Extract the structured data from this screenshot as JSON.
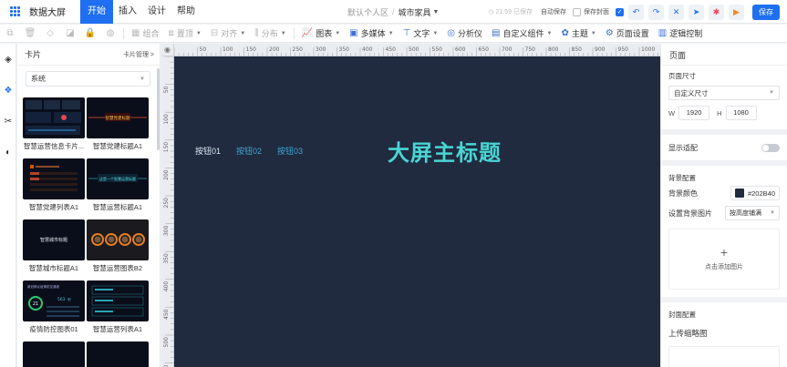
{
  "app": {
    "title": "数据大屏"
  },
  "menu": [
    {
      "label": "开始",
      "active": true
    },
    {
      "label": "插入",
      "active": false
    },
    {
      "label": "设计",
      "active": false
    },
    {
      "label": "帮助",
      "active": false
    }
  ],
  "breadcrumb": {
    "space": "默认个人区",
    "separator": "/",
    "current": "城市家具"
  },
  "header_tools": {
    "saved_time": "21:59 已保存",
    "auto_save_label": "自动保存",
    "save_cover_label": "保存封面",
    "save_button": "保存"
  },
  "toolbar": {
    "items": [
      {
        "label": "组合",
        "icon": "group-icon",
        "enabled": false,
        "dropdown": false
      },
      {
        "label": "置顶",
        "icon": "bring-front-icon",
        "enabled": false,
        "dropdown": true
      },
      {
        "label": "对齐",
        "icon": "align-icon",
        "enabled": false,
        "dropdown": true
      },
      {
        "label": "分布",
        "icon": "distribute-icon",
        "enabled": false,
        "dropdown": true
      },
      {
        "label": "图表",
        "icon": "chart-icon",
        "enabled": true,
        "dropdown": true
      },
      {
        "label": "多媒体",
        "icon": "media-icon",
        "enabled": true,
        "dropdown": true
      },
      {
        "label": "文字",
        "icon": "text-icon",
        "enabled": true,
        "dropdown": true
      },
      {
        "label": "分析仪",
        "icon": "analyzer-icon",
        "enabled": true,
        "dropdown": false
      },
      {
        "label": "自定义组件",
        "icon": "custom-component-icon",
        "enabled": true,
        "dropdown": true
      },
      {
        "label": "主题",
        "icon": "theme-icon",
        "enabled": true,
        "dropdown": true
      },
      {
        "label": "页面设置",
        "icon": "page-settings-icon",
        "enabled": true,
        "dropdown": false
      },
      {
        "label": "逻辑控制",
        "icon": "logic-control-icon",
        "enabled": true,
        "dropdown": false
      }
    ]
  },
  "card_panel": {
    "title": "卡片",
    "manage_label": "卡片管理 >",
    "category_select": "系统",
    "cards": [
      {
        "label": "智慧运营信息卡片..."
      },
      {
        "label": "智慧党建标题A1"
      },
      {
        "label": "智慧党建列表A1"
      },
      {
        "label": "智慧运营标题A1"
      },
      {
        "label": "智慧城市标题A1"
      },
      {
        "label": "智慧运营图表B2"
      },
      {
        "label": "疫情防控图表01"
      },
      {
        "label": "智慧运营列表A1"
      }
    ],
    "thumb_texts": {
      "party_title": "智慧党建标题",
      "ops_title": "这是一个智慧运营标题",
      "city_title": "智慧城市标题",
      "epidemic_heading": "新冠肺炎疫情防控通报",
      "epidemic_percent": "21",
      "epidemic_count": "563",
      "epidemic_unit": "例"
    }
  },
  "rulers": {
    "top": [
      "50",
      "100",
      "150",
      "200",
      "250",
      "300",
      "350",
      "400",
      "450",
      "500",
      "550",
      "600",
      "650",
      "700",
      "750",
      "800",
      "850",
      "900",
      "950",
      "1000",
      "1050"
    ],
    "left": [
      "50",
      "100",
      "150",
      "200",
      "250",
      "300",
      "350",
      "400",
      "450",
      "500",
      "550"
    ]
  },
  "stage": {
    "buttons": [
      "按钮01",
      "按钮02",
      "按钮03"
    ],
    "title": "大屏主标题"
  },
  "right_panel": {
    "title": "页面",
    "page_size_label": "页面尺寸",
    "page_size_value": "自定义尺寸",
    "width_label": "W",
    "width_value": "1920",
    "height_label": "H",
    "height_value": "1080",
    "display_adapt_label": "显示适配",
    "bg_section_label": "背景配置",
    "bg_color_label": "背景颜色",
    "bg_color_value": "#202B40",
    "bg_image_label": "设置背景图片",
    "bg_image_mode": "按高度铺满",
    "add_image_label": "点击添加图片",
    "cover_section_label": "封面配置",
    "upload_thumb_label": "上传缩略图"
  },
  "colors": {
    "accent": "#1e6ff1",
    "canvas_bg": "#202B40",
    "title_color": "#49d6d4",
    "button_color": "#3ea6cf"
  }
}
